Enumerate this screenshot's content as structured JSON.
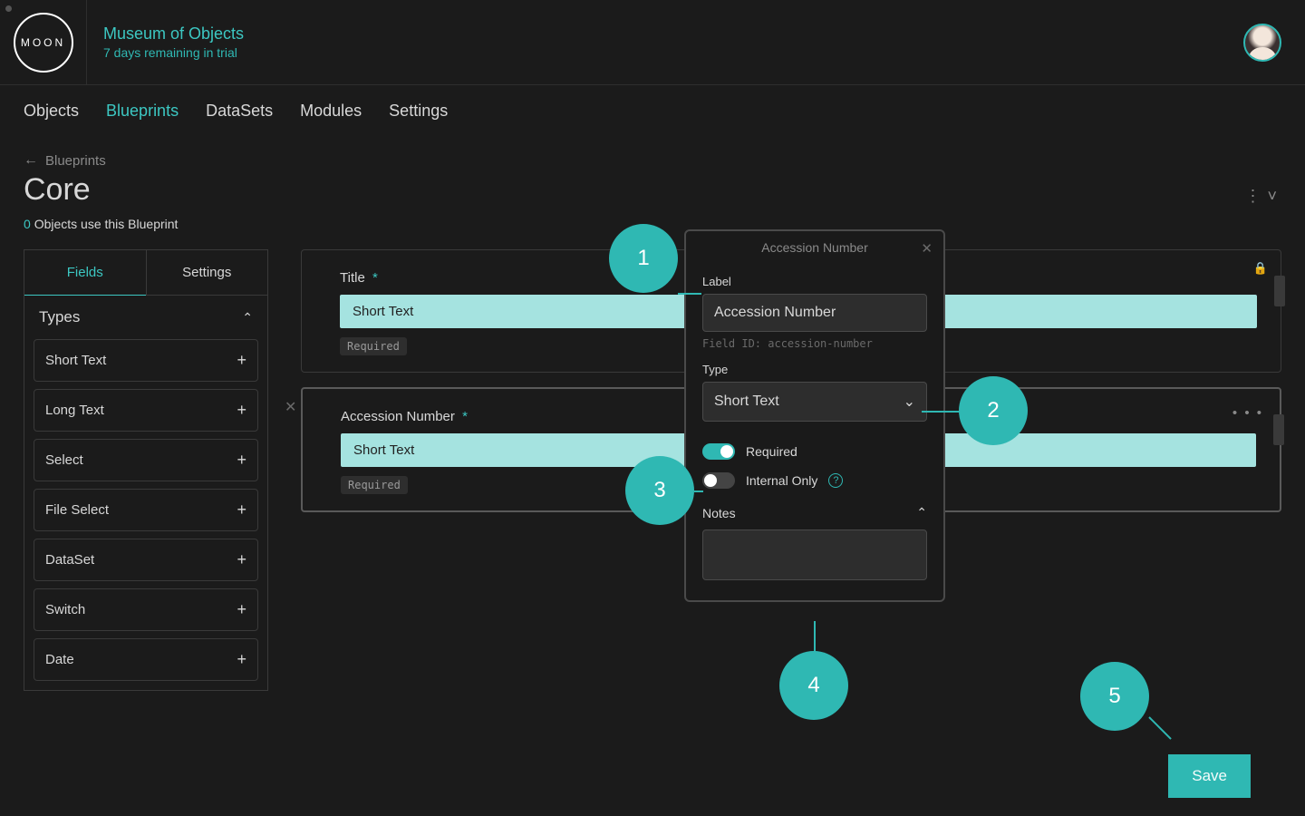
{
  "header": {
    "logo_text": "MOON",
    "org_name": "Museum of Objects",
    "trial_text": "7 days remaining in trial"
  },
  "nav": {
    "items": [
      {
        "label": "Objects",
        "active": false
      },
      {
        "label": "Blueprints",
        "active": true
      },
      {
        "label": "DataSets",
        "active": false
      },
      {
        "label": "Modules",
        "active": false
      },
      {
        "label": "Settings",
        "active": false
      }
    ]
  },
  "breadcrumb": {
    "label": "Blueprints"
  },
  "page": {
    "title": "Core",
    "usage_count": "0",
    "usage_text": "Objects use this Blueprint"
  },
  "sidebar": {
    "tabs": [
      {
        "label": "Fields",
        "active": true
      },
      {
        "label": "Settings",
        "active": false
      }
    ],
    "types_header": "Types",
    "types": [
      "Short Text",
      "Long Text",
      "Select",
      "File Select",
      "DataSet",
      "Switch",
      "Date"
    ]
  },
  "fields": [
    {
      "label": "Title",
      "type": "Short Text",
      "required": true,
      "locked": true,
      "tag": "Required"
    },
    {
      "label": "Accession Number",
      "type": "Short Text",
      "required": true,
      "selected": true,
      "tag": "Required"
    }
  ],
  "panel": {
    "title": "Accession Number",
    "label_label": "Label",
    "label_value": "Accession Number",
    "field_id_text": "Field ID: accession-number",
    "type_label": "Type",
    "type_value": "Short Text",
    "required_label": "Required",
    "required_on": true,
    "internal_label": "Internal Only",
    "internal_on": false,
    "notes_label": "Notes",
    "notes_value": ""
  },
  "annotations": {
    "b1": "1",
    "b2": "2",
    "b3": "3",
    "b4": "4",
    "b5": "5"
  },
  "actions": {
    "save": "Save"
  }
}
